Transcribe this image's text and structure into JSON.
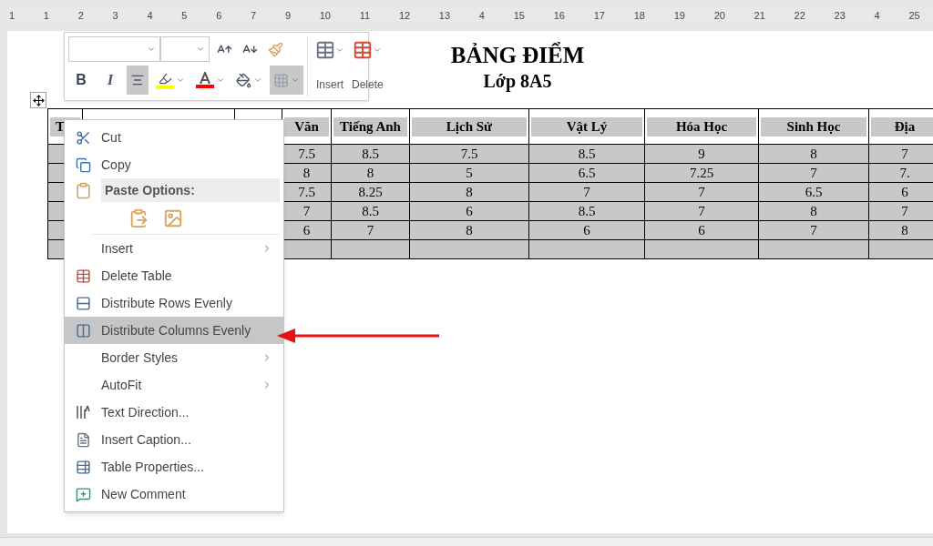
{
  "ruler": [
    "1",
    "1",
    "2",
    "3",
    "4",
    "5",
    "6",
    "7",
    "9",
    "10",
    "11",
    "12",
    "13",
    "4",
    "15",
    "16",
    "17",
    "18",
    "19",
    "20",
    "21",
    "22",
    "23",
    "4",
    "25"
  ],
  "mini_toolbar": {
    "top_buttons": [
      {
        "kind": "grow"
      },
      {
        "kind": "shrink"
      },
      {
        "kind": "painter"
      }
    ],
    "bottom_buttons": [
      {
        "kind": "bold",
        "label": "B",
        "selected": false
      },
      {
        "kind": "italic",
        "label": "I",
        "selected": false
      },
      {
        "kind": "align",
        "selected": true
      },
      {
        "kind": "highlight",
        "color": "#ffff00",
        "selected": false
      },
      {
        "kind": "fontcolor",
        "color": "#ff0000",
        "selected": false
      },
      {
        "kind": "shading",
        "selected": false
      },
      {
        "kind": "borders",
        "selected": true
      }
    ],
    "table_buttons": [
      {
        "kind": "insert",
        "label": "Insert"
      },
      {
        "kind": "delete",
        "label": "Delete"
      }
    ]
  },
  "document": {
    "title": "BẢNG ĐIỂM",
    "subtitle": "Lớp 8A5",
    "table": {
      "columns": [
        "T",
        "",
        "",
        "Văn",
        "Tiếng Anh",
        "Lịch Sử",
        "Vật Lý",
        "Hóa Học",
        "Sinh Học",
        "Địa"
      ],
      "rows": [
        [
          "",
          "",
          "",
          "7.5",
          "8.5",
          "7.5",
          "8.5",
          "9",
          "8",
          "7"
        ],
        [
          "",
          "",
          "",
          "8",
          "8",
          "5",
          "6.5",
          "7.25",
          "7",
          "7."
        ],
        [
          "",
          "",
          "",
          "7.5",
          "8.25",
          "8",
          "7",
          "7",
          "6.5",
          "6"
        ],
        [
          "",
          "",
          "",
          "7",
          "8.5",
          "6",
          "8.5",
          "7",
          "8",
          "7"
        ],
        [
          "",
          "",
          "",
          "6",
          "7",
          "8",
          "6",
          "6",
          "7",
          "8"
        ],
        [
          "",
          "",
          "",
          "",
          "",
          "",
          "",
          "",
          "",
          ""
        ]
      ]
    }
  },
  "context_menu": [
    {
      "kind": "item",
      "label": "Cut",
      "selected": false
    },
    {
      "kind": "item",
      "label": "Copy",
      "selected": false
    },
    {
      "kind": "header",
      "label": "Paste Options:"
    },
    {
      "kind": "paste_icons"
    },
    {
      "kind": "item",
      "label": "Insert",
      "submenu": true,
      "selected": false
    },
    {
      "kind": "item",
      "label": "Delete Table",
      "selected": false
    },
    {
      "kind": "item",
      "label": "Distribute Rows Evenly",
      "selected": false
    },
    {
      "kind": "item",
      "label": "Distribute Columns Evenly",
      "selected": true
    },
    {
      "kind": "item",
      "label": "Border Styles",
      "submenu": true,
      "selected": false
    },
    {
      "kind": "item",
      "label": "AutoFit",
      "submenu": true,
      "selected": false
    },
    {
      "kind": "item",
      "label": "Text Direction...",
      "selected": false
    },
    {
      "kind": "item",
      "label": "Insert Caption...",
      "selected": false
    },
    {
      "kind": "item",
      "label": "Table Properties...",
      "selected": false
    },
    {
      "kind": "item",
      "label": "New Comment",
      "selected": false
    }
  ]
}
